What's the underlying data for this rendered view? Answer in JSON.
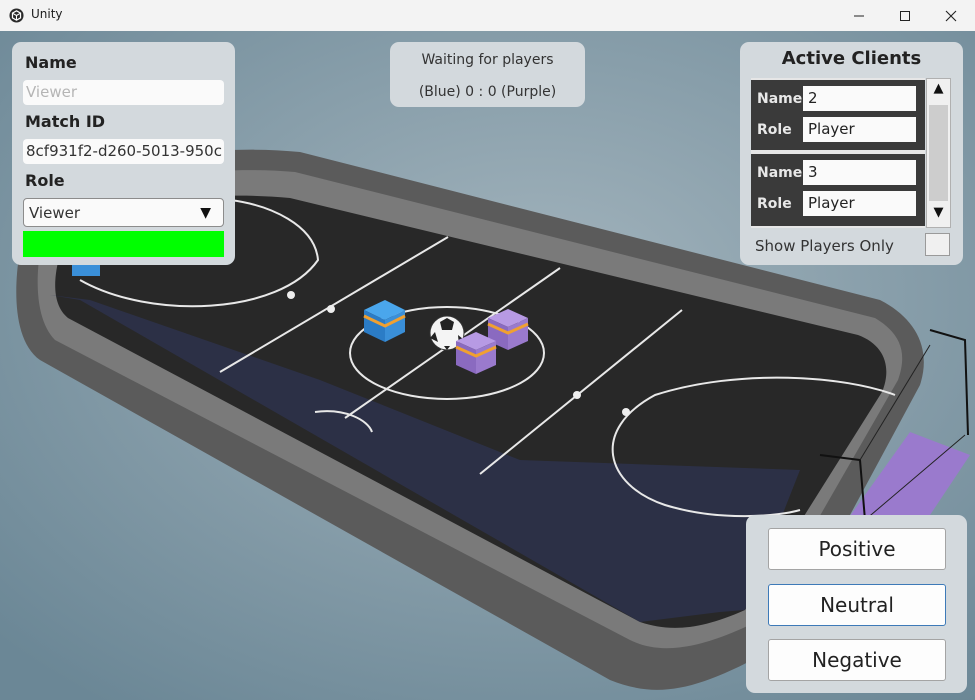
{
  "window": {
    "title": "Unity"
  },
  "identity": {
    "name_label": "Name",
    "name_placeholder": "Viewer",
    "match_label": "Match ID",
    "match_value": "8cf931f2-d260-5013-950c",
    "role_label": "Role",
    "role_value": "Viewer",
    "status_color": "#00ff00"
  },
  "status": {
    "line1": "Waiting for players",
    "line2": "(Blue) 0 : 0 (Purple)"
  },
  "clients": {
    "title": "Active Clients",
    "name_key": "Name",
    "role_key": "Role",
    "items": [
      {
        "name": "2",
        "role": "Player"
      },
      {
        "name": "3",
        "role": "Player"
      }
    ],
    "filter_label": "Show Players Only"
  },
  "feedback": {
    "positive": "Positive",
    "neutral": "Neutral",
    "negative": "Negative"
  },
  "colors": {
    "blue_team": "#3a8fd8",
    "purple_team": "#9a7acd",
    "field": "#282828"
  }
}
